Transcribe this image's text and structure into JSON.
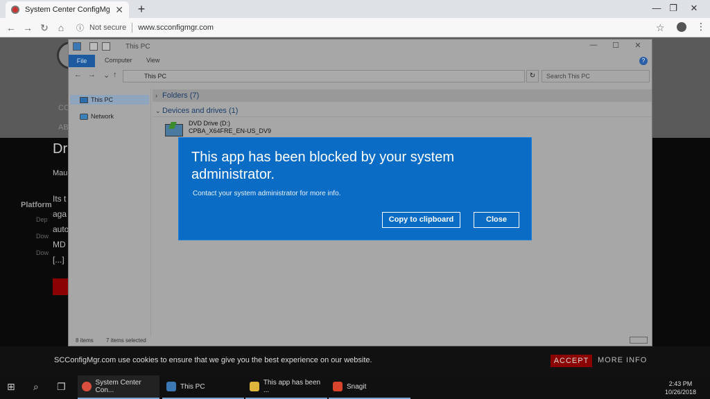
{
  "browser": {
    "tab_title": "System Center ConfigMgr",
    "tab_close": "✕",
    "new_tab": "+",
    "window_controls": [
      "—",
      "❐",
      "✕"
    ],
    "security": "Not secure",
    "url": "www.scconfigmgr.com",
    "back": "←",
    "forward": "→",
    "reload": "↻",
    "home": "⌂",
    "info": "ⓘ",
    "star": "☆",
    "menu": "⋮"
  },
  "page_ghost": {
    "nav1": "CO",
    "nav2": "AB",
    "heading": "Dr",
    "author": "Mau",
    "body_lines": [
      "Its t",
      "aga",
      "auto",
      "MD",
      "[...]"
    ],
    "sidebar_title": "Platform",
    "sidebar_items": [
      "Dep",
      "Dow",
      "Dow"
    ]
  },
  "cookie": {
    "message": "SCConfigMgr.com use cookies to ensure that we give you the best experience on our website.",
    "accept": "ACCEPT",
    "more": "MORE INFO"
  },
  "explorer": {
    "title": "This PC",
    "window_controls": [
      "—",
      "☐",
      "✕"
    ],
    "ribbon_tabs": [
      "File",
      "Computer",
      "View"
    ],
    "help": "?",
    "address": "This PC",
    "search_placeholder": "Search This PC",
    "nav_items": [
      "This PC",
      "Network"
    ],
    "groups": [
      "Folders (7)",
      "Devices and drives (1)"
    ],
    "drive_name": "DVD Drive (D:)",
    "drive_label": "CPBA_X64FRE_EN-US_DV9",
    "status_items": "8 items",
    "status_selected": "7 items selected"
  },
  "dialog": {
    "heading": "This app has been blocked by your system administrator.",
    "message": "Contact your system administrator for more info.",
    "copy_button": "Copy to clipboard",
    "close_button": "Close",
    "accent": "#0a6cc4"
  },
  "taskbar": {
    "tasks": [
      "System Center Con...",
      "This PC",
      "This app has been ...",
      "Snagit"
    ],
    "time": "2:43 PM",
    "date": "10/26/2018"
  }
}
